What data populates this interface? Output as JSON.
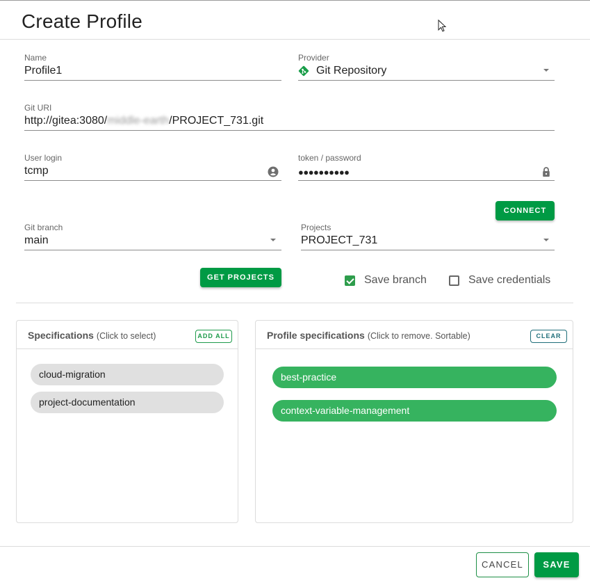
{
  "dialog": {
    "title": "Create Profile"
  },
  "form": {
    "name": {
      "label": "Name",
      "value": "Profile1"
    },
    "provider": {
      "label": "Provider",
      "value": "Git Repository",
      "icon": "git-icon",
      "icon_color": "#1a9e4a"
    },
    "git_uri": {
      "label": "Git URI",
      "value_prefix": "http://gitea:3080/",
      "value_redacted": "middle-earth",
      "value_suffix": "/PROJECT_731.git"
    },
    "user_login": {
      "label": "User login",
      "value": "tcmp",
      "icon": "account-circle-icon"
    },
    "token": {
      "label": "token / password",
      "value": "●●●●●●●●●●",
      "icon": "lock-icon"
    },
    "connect_button": "CONNECT",
    "git_branch": {
      "label": "Git branch",
      "value": "main"
    },
    "projects": {
      "label": "Projects",
      "value": "PROJECT_731"
    },
    "get_projects_button": "GET PROJECTS",
    "save_branch": {
      "label": "Save branch",
      "checked": true
    },
    "save_credentials": {
      "label": "Save credentials",
      "checked": false
    }
  },
  "specifications": {
    "title": "Specifications",
    "subtitle": "(Click to select)",
    "add_all_button": "ADD ALL",
    "items": [
      "cloud-migration",
      "project-documentation"
    ]
  },
  "profile_specifications": {
    "title": "Profile specifications",
    "subtitle": "(Click to remove. Sortable)",
    "clear_button": "CLEAR",
    "items": [
      "best-practice",
      "context-variable-management"
    ]
  },
  "footer": {
    "cancel_button": "CANCEL",
    "save_button": "SAVE"
  },
  "colors": {
    "primary_green": "#009a44",
    "chip_green": "#36b35f",
    "chip_grey": "#e0e0e0"
  }
}
